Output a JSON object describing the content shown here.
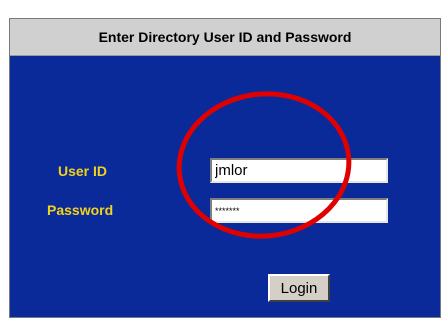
{
  "dialog": {
    "title": "Enter Directory User ID and Password"
  },
  "form": {
    "user_id_label": "User ID",
    "user_id_value": "jmlor",
    "password_label": "Password",
    "password_value": "*******",
    "login_label": "Login"
  },
  "colors": {
    "panel_background": "#0a2a9a",
    "label_color": "#f2d21a",
    "title_bar": "#d0d0d0",
    "annotation_circle": "#e00000"
  }
}
